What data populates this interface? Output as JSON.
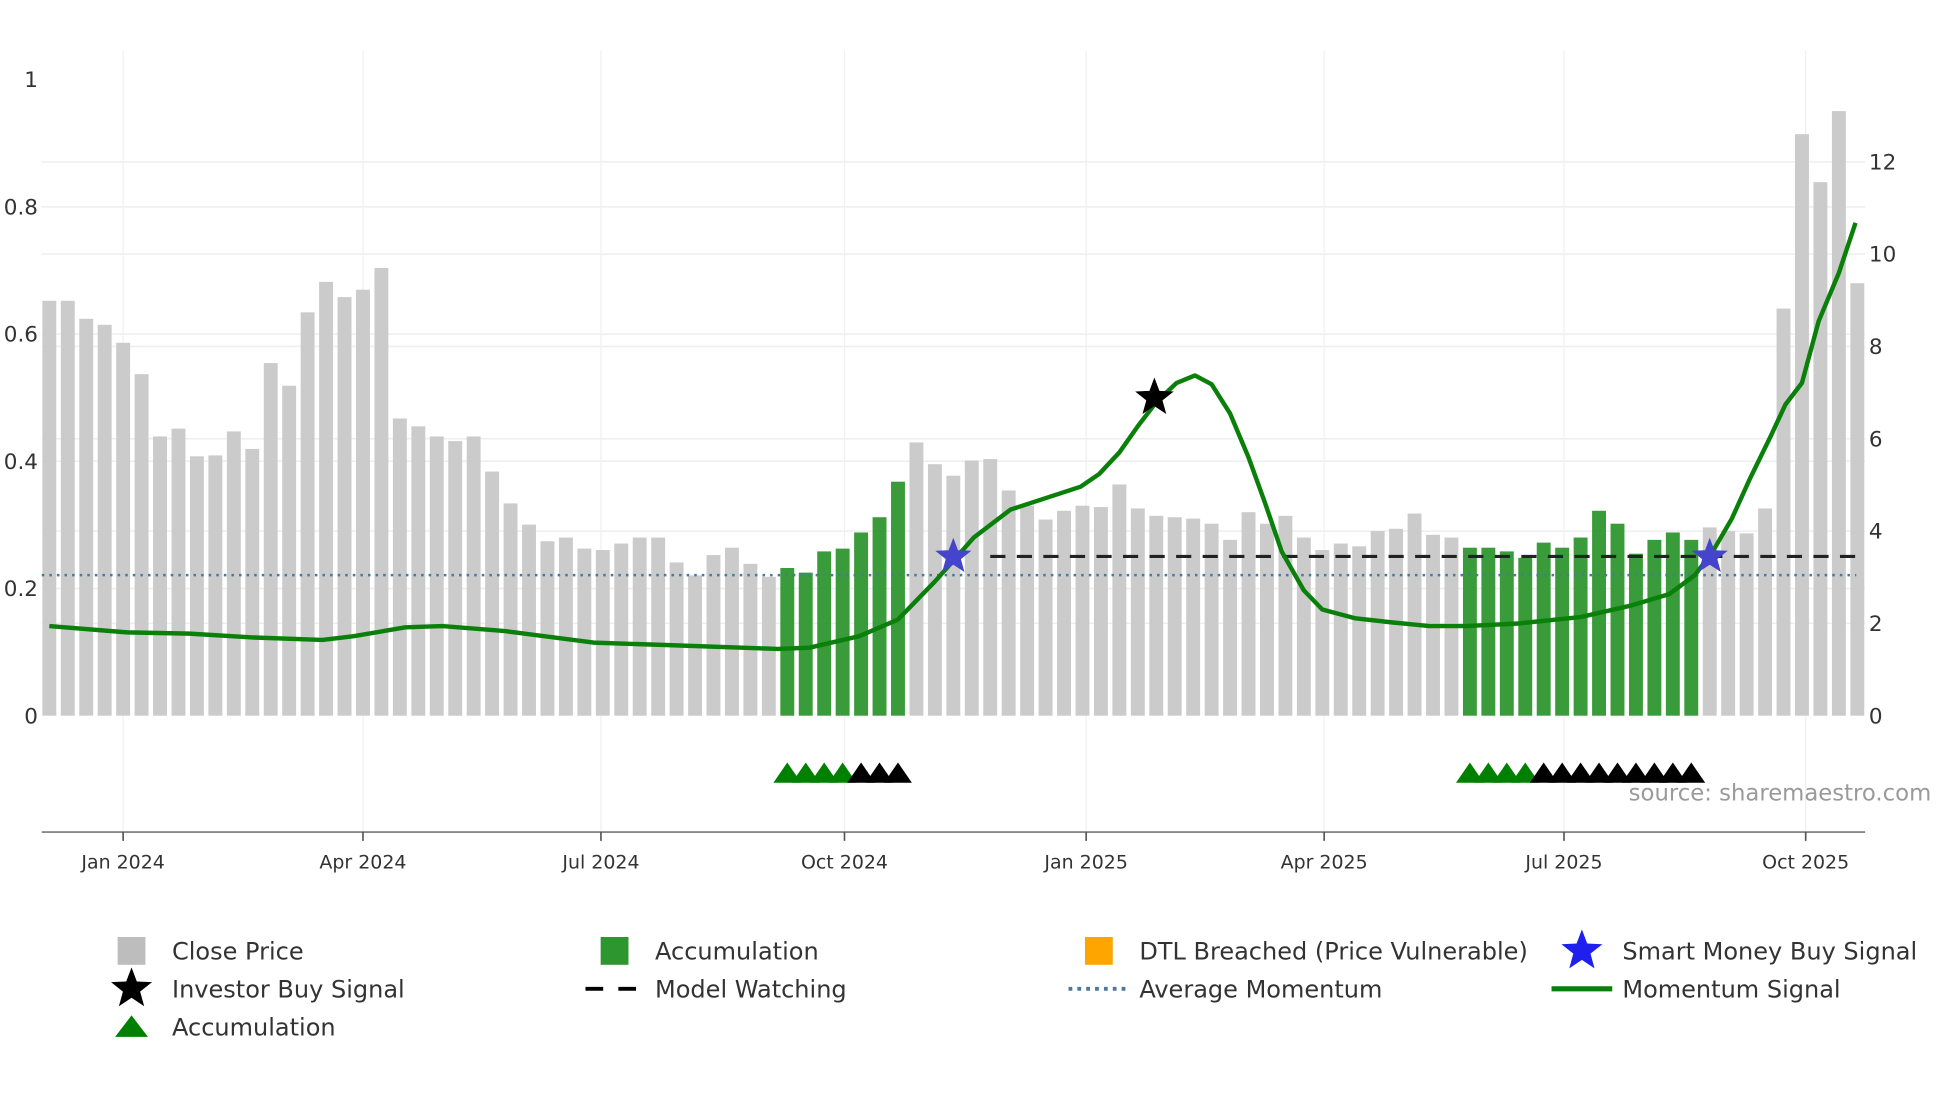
{
  "chart_data": {
    "type": "bar",
    "title": "",
    "source": "source: sharemaestro.com",
    "x_unit": "week index (week 0 ≈ early Dec 2023)",
    "x_ticks": [
      {
        "label": "Jan 2024",
        "x": 4.0
      },
      {
        "label": "Apr 2024",
        "x": 17.0
      },
      {
        "label": "Jul 2024",
        "x": 29.9
      },
      {
        "label": "Oct 2024",
        "x": 43.1
      },
      {
        "label": "Jan 2025",
        "x": 56.2
      },
      {
        "label": "Apr 2025",
        "x": 69.1
      },
      {
        "label": "Jul 2025",
        "x": 82.1
      },
      {
        "label": "Oct 2025",
        "x": 95.2
      }
    ],
    "left_axis": {
      "range": [
        0,
        1
      ],
      "ticks": [
        "0",
        "0.2",
        "0.4",
        "0.6",
        "0.8",
        "1"
      ]
    },
    "right_axis": {
      "range": [
        0,
        13.8
      ],
      "ticks": [
        "0",
        "2",
        "4",
        "6",
        "8",
        "10",
        "12"
      ]
    },
    "close_price": [
      8.99,
      8.99,
      8.6,
      8.47,
      8.08,
      7.4,
      6.05,
      6.22,
      5.62,
      5.64,
      6.16,
      5.78,
      7.64,
      7.15,
      8.74,
      9.4,
      9.07,
      9.23,
      9.7,
      6.44,
      6.27,
      6.05,
      5.95,
      6.05,
      5.29,
      4.6,
      4.14,
      3.78,
      3.86,
      3.62,
      3.59,
      3.73,
      3.86,
      3.86,
      3.32,
      3.04,
      3.48,
      3.64,
      3.29,
      3.01,
      3.2,
      3.1,
      3.56,
      3.62,
      3.97,
      4.3,
      5.07,
      5.92,
      5.45,
      5.2,
      5.53,
      5.56,
      4.88,
      4.55,
      4.25,
      4.44,
      4.55,
      4.52,
      5.01,
      4.49,
      4.33,
      4.3,
      4.27,
      4.16,
      3.81,
      4.41,
      4.16,
      4.33,
      3.86,
      3.59,
      3.73,
      3.67,
      4.0,
      4.05,
      4.38,
      3.92,
      3.86,
      3.64,
      3.64,
      3.56,
      3.42,
      3.75,
      3.64,
      3.86,
      4.44,
      4.16,
      3.51,
      3.81,
      3.97,
      3.81,
      4.08,
      4.0,
      3.95,
      4.49,
      8.82,
      12.6,
      11.56,
      13.1,
      9.37
    ],
    "accumulation_ranges": [
      [
        40,
        46
      ],
      [
        77,
        89
      ]
    ],
    "momentum_signal": [
      [
        0,
        0.141
      ],
      [
        4.2,
        0.131
      ],
      [
        7.6,
        0.129
      ],
      [
        11,
        0.123
      ],
      [
        14.8,
        0.119
      ],
      [
        16.5,
        0.125
      ],
      [
        19.3,
        0.139
      ],
      [
        21.3,
        0.141
      ],
      [
        24.7,
        0.133
      ],
      [
        29.5,
        0.115
      ],
      [
        33.6,
        0.111
      ],
      [
        39.5,
        0.105
      ],
      [
        41.2,
        0.107
      ],
      [
        43.9,
        0.125
      ],
      [
        46,
        0.151
      ],
      [
        48,
        0.211
      ],
      [
        50.1,
        0.28
      ],
      [
        52.1,
        0.324
      ],
      [
        54.2,
        0.344
      ],
      [
        55.9,
        0.36
      ],
      [
        56.9,
        0.38
      ],
      [
        58,
        0.414
      ],
      [
        59,
        0.455
      ],
      [
        60,
        0.493
      ],
      [
        61.1,
        0.523
      ],
      [
        62.1,
        0.535
      ],
      [
        63,
        0.521
      ],
      [
        64,
        0.475
      ],
      [
        65,
        0.406
      ],
      [
        65.9,
        0.334
      ],
      [
        66.8,
        0.258
      ],
      [
        68,
        0.197
      ],
      [
        69,
        0.167
      ],
      [
        70.8,
        0.153
      ],
      [
        72.7,
        0.147
      ],
      [
        74.8,
        0.141
      ],
      [
        76.8,
        0.141
      ],
      [
        79.6,
        0.145
      ],
      [
        83,
        0.155
      ],
      [
        85.7,
        0.173
      ],
      [
        87.8,
        0.191
      ],
      [
        89.2,
        0.221
      ],
      [
        90.2,
        0.26
      ],
      [
        91.2,
        0.31
      ],
      [
        92.2,
        0.374
      ],
      [
        93.3,
        0.439
      ],
      [
        94.1,
        0.489
      ],
      [
        95,
        0.523
      ],
      [
        95.9,
        0.62
      ],
      [
        97,
        0.696
      ],
      [
        97.9,
        0.775
      ]
    ],
    "average_momentum": 0.221,
    "model_watching": {
      "value": 3.45,
      "from_x": 51,
      "to_x": 98
    },
    "investor_buy_signals": [
      [
        59.9,
        0.5
      ]
    ],
    "smart_money_buy_signals": [
      [
        49,
        0.25
      ],
      [
        90,
        0.25
      ]
    ],
    "triangles_green": [
      40,
      41,
      42,
      43,
      77,
      78,
      79,
      80
    ],
    "triangles_black": [
      44,
      45,
      46,
      81,
      82,
      83,
      84,
      85,
      86,
      87,
      88,
      89
    ],
    "legend": [
      {
        "label": "Close Price",
        "icon": "grey-square"
      },
      {
        "label": "Accumulation",
        "icon": "green-square"
      },
      {
        "label": "DTL Breached (Price Vulnerable)",
        "icon": "orange-square"
      },
      {
        "label": "Smart Money Buy Signal",
        "icon": "blue-star"
      },
      {
        "label": "Investor Buy Signal",
        "icon": "black-star"
      },
      {
        "label": "Model Watching",
        "icon": "black-dash"
      },
      {
        "label": "Average Momentum",
        "icon": "blue-dotted"
      },
      {
        "label": "Momentum Signal",
        "icon": "green-line"
      },
      {
        "label": "Accumulation",
        "icon": "green-triangle"
      }
    ],
    "colors": {
      "price": "#c8c8c8",
      "accumulation": "#2e962e",
      "dtl": "#ffa500",
      "smart": "#2020ee",
      "momentum": "#0a800a",
      "avg": "#4a7a9a"
    }
  }
}
